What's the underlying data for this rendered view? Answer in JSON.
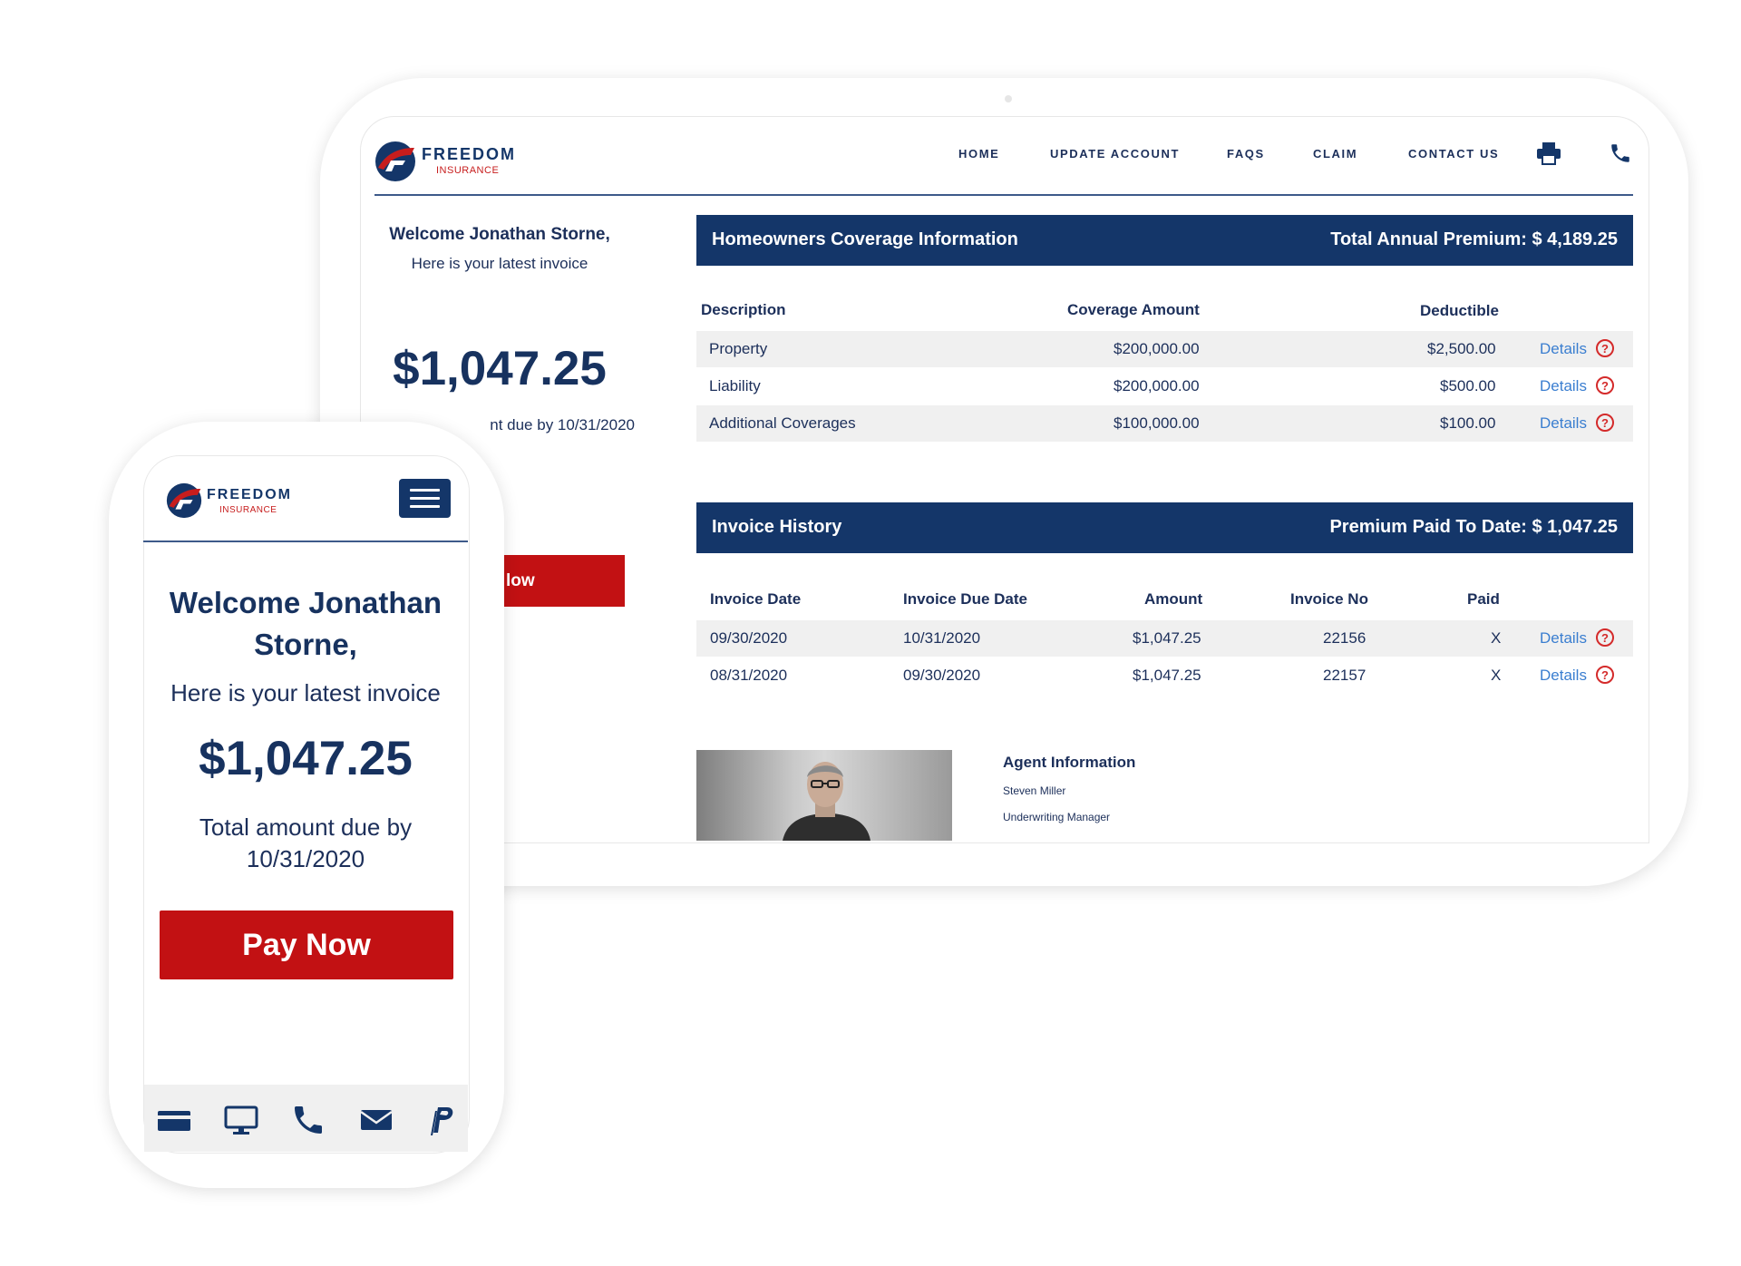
{
  "colors": {
    "navy": "#143669",
    "red": "#c21113",
    "link": "#3a7ed0",
    "shade": "#f0f0f0"
  },
  "brand": {
    "name": "FREEDOM",
    "sub": "INSURANCE"
  },
  "nav": {
    "items": [
      "HOME",
      "UPDATE ACCOUNT",
      "FAQS",
      "CLAIM",
      "CONTACT US"
    ],
    "icons": [
      "printer-icon",
      "phone-icon"
    ]
  },
  "tablet": {
    "welcome": "Welcome Jonathan Storne,",
    "latest": "Here is your latest invoice",
    "amount": "$1,047.25",
    "due_partial": "nt due by 10/31/2020",
    "pay_partial": "low"
  },
  "coverage": {
    "title": "Homeowners Coverage Information",
    "total": "Total Annual Premium: $ 4,189.25",
    "headers": [
      "Description",
      "Coverage Amount",
      "Deductible"
    ],
    "rows": [
      {
        "description": "Property",
        "amount": "$200,000.00",
        "deductible": "$2,500.00",
        "link": "Details"
      },
      {
        "description": "Liability",
        "amount": "$200,000.00",
        "deductible": "$500.00",
        "link": "Details"
      },
      {
        "description": "Additional Coverages",
        "amount": "$100,000.00",
        "deductible": "$100.00",
        "link": "Details"
      }
    ]
  },
  "invoices": {
    "title": "Invoice History",
    "paid_to_date": "Premium Paid To Date: $ 1,047.25",
    "headers": [
      "Invoice Date",
      "Invoice Due Date",
      "Amount",
      "Invoice No",
      "Paid"
    ],
    "rows": [
      {
        "date": "09/30/2020",
        "due": "10/31/2020",
        "amount": "$1,047.25",
        "number": "22156",
        "paid": "X",
        "link": "Details"
      },
      {
        "date": "08/31/2020",
        "due": "09/30/2020",
        "amount": "$1,047.25",
        "number": "22157",
        "paid": "X",
        "link": "Details"
      }
    ]
  },
  "agent": {
    "title": "Agent Information",
    "name": "Steven Miller",
    "role": "Underwriting Manager"
  },
  "phone": {
    "welcome_line1": "Welcome Jonathan",
    "welcome_line2": "Storne,",
    "latest": "Here is your latest invoice",
    "amount": "$1,047.25",
    "due_line1": "Total amount due by",
    "due_line2": "10/31/2020",
    "pay": "Pay Now",
    "footer_icons": [
      "credit-card-icon",
      "desktop-icon",
      "phone-icon",
      "mail-icon",
      "paypal-icon"
    ]
  }
}
